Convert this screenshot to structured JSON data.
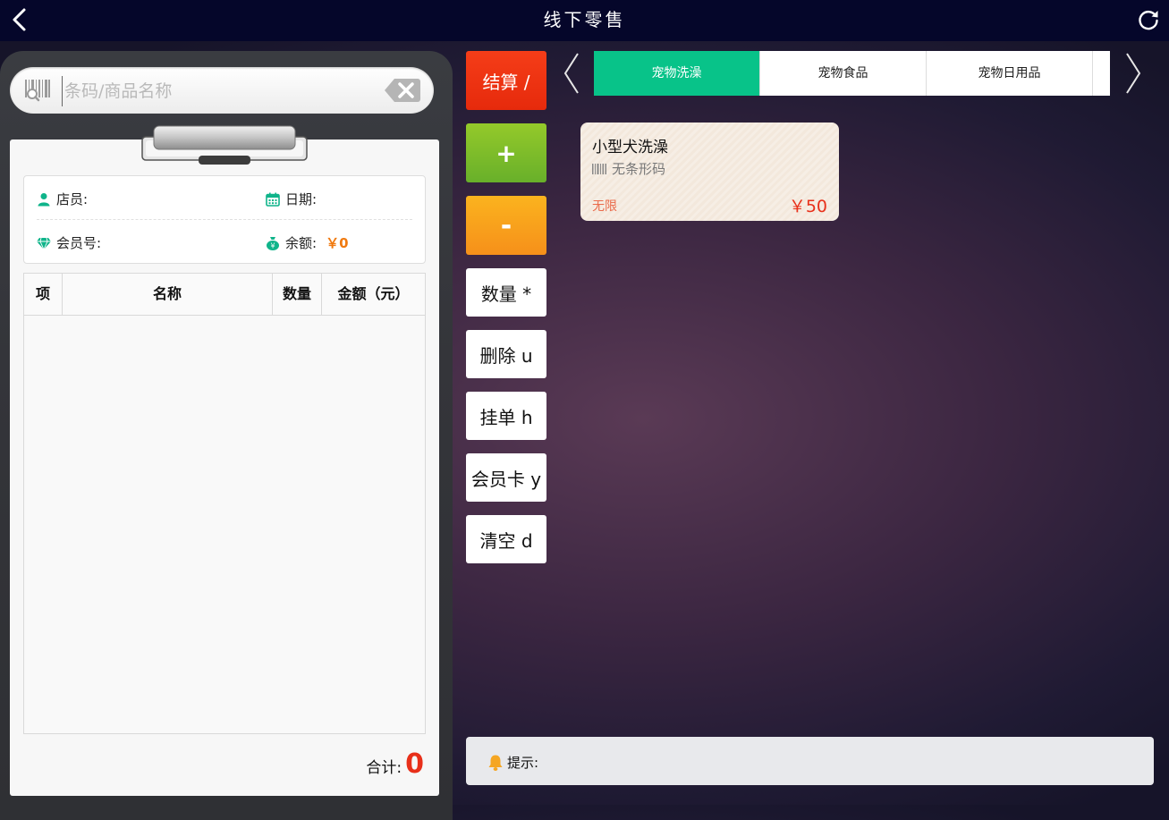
{
  "header": {
    "title": "线下零售",
    "back_icon": "chevron-left-icon",
    "refresh_icon": "refresh-icon"
  },
  "search": {
    "placeholder": "条码/商品名称",
    "value": "",
    "barcode_icon": "barcode-search-icon",
    "clear_icon": "backspace-clear-icon"
  },
  "info": {
    "clerk_label": "店员:",
    "clerk_value": "",
    "date_label": "日期:",
    "date_value": "",
    "member_label": "会员号:",
    "member_value": "",
    "balance_label": "余额:",
    "balance_value": "￥0"
  },
  "table": {
    "columns": [
      "项",
      "名称",
      "数量",
      "金额（元）"
    ],
    "rows": []
  },
  "total": {
    "label": "合计:",
    "value": "0"
  },
  "actions": {
    "checkout": "结算 /",
    "plus": "+",
    "minus": "-",
    "quantity": "数量 *",
    "delete": "删除 u",
    "hang": "挂单 h",
    "member_card": "会员卡 y",
    "clear": "清空 d"
  },
  "categories": {
    "tabs": [
      {
        "label": "宠物洗澡",
        "active": true
      },
      {
        "label": "宠物食品",
        "active": false
      },
      {
        "label": "宠物日用品",
        "active": false
      }
    ]
  },
  "products": [
    {
      "name": "小型犬洗澡",
      "code": "无条形码",
      "stock": "无限",
      "price": "￥50"
    }
  ],
  "tip": {
    "label": "提示:",
    "text": ""
  },
  "colors": {
    "accent_green": "#08c389",
    "checkout_red": "#e62a0c",
    "plus_green": "#6cb12a",
    "minus_orange": "#f6901a",
    "price_red": "#e8301a",
    "balance_orange": "#f07a10",
    "topbar": "#05062a"
  }
}
